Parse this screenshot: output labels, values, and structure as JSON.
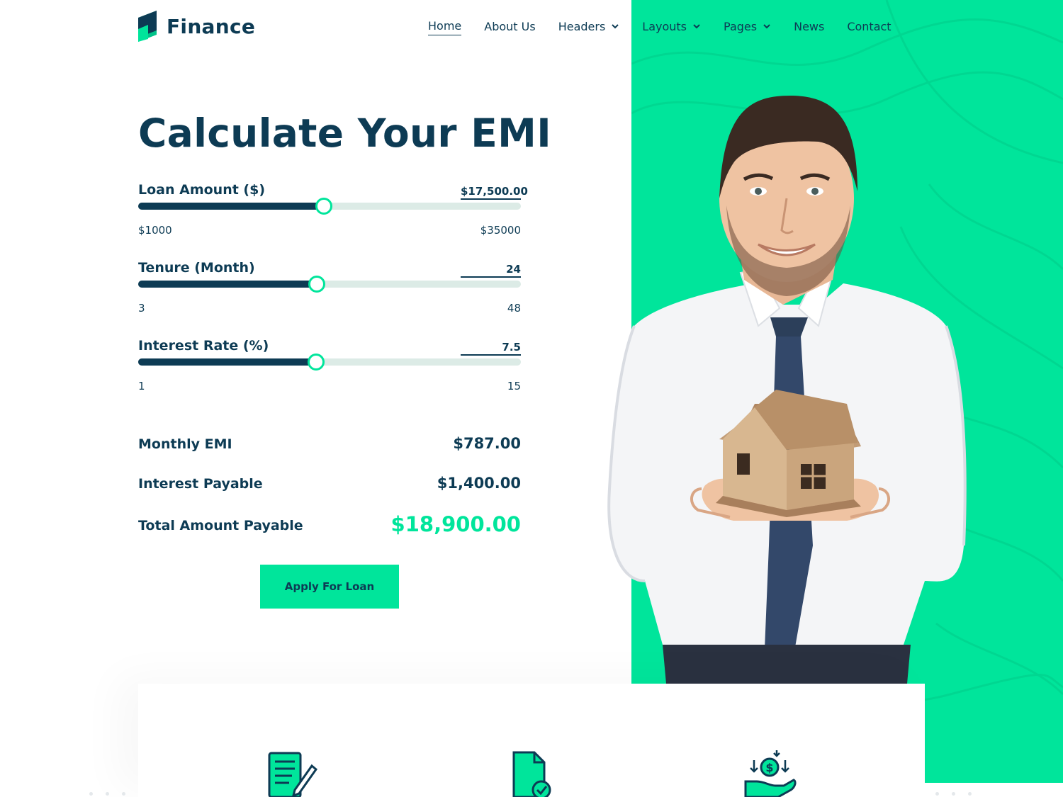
{
  "brand": {
    "name": "Finance",
    "accent": "#00e59b",
    "dark": "#0d3b54"
  },
  "nav": [
    {
      "label": "Home",
      "active": true,
      "dropdown": false
    },
    {
      "label": "About Us",
      "dropdown": false
    },
    {
      "label": "Headers",
      "dropdown": true
    },
    {
      "label": "Layouts",
      "dropdown": true
    },
    {
      "label": "Pages",
      "dropdown": true
    },
    {
      "label": "News",
      "dropdown": false
    },
    {
      "label": "Contact",
      "dropdown": false
    }
  ],
  "calculator": {
    "title": "Calculate Your EMI",
    "fields": [
      {
        "label": "Loan Amount ($)",
        "value": "$17,500.00",
        "min_label": "$1000",
        "max_label": "$35000",
        "level": 0.485
      },
      {
        "label": "Tenure (Month)",
        "value": "24",
        "min_label": "3",
        "max_label": "48",
        "level": 0.467
      },
      {
        "label": "Interest Rate (%)",
        "value": "7.5",
        "min_label": "1",
        "max_label": "15",
        "level": 0.464
      }
    ],
    "results": [
      {
        "label": "Monthly EMI",
        "value": "$787.00"
      },
      {
        "label": "Interest Payable",
        "value": "$1,400.00"
      },
      {
        "label": "Total Amount Payable",
        "value": "$18,900.00"
      }
    ],
    "apply_label": "Apply For Loan"
  },
  "features": [
    {
      "icon": "document-pen-icon"
    },
    {
      "icon": "file-check-icon"
    },
    {
      "icon": "money-hand-icon"
    }
  ]
}
